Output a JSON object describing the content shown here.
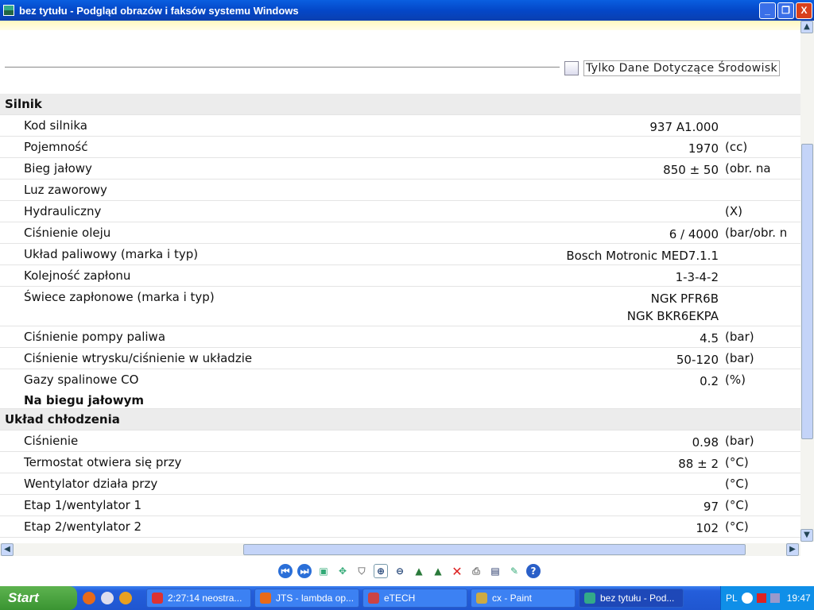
{
  "window": {
    "title": "bez tytułu - Podgląd obrazów i faksów systemu Windows",
    "min": "_",
    "max": "❐",
    "close": "X"
  },
  "env_checkbox": {
    "label": "Tylko Dane Dotyczące Środowisk",
    "checked": false
  },
  "sections": [
    {
      "title": "Silnik",
      "rows": [
        {
          "label": "Kod silnika",
          "value": "937 A1.000",
          "unit": ""
        },
        {
          "label": "Pojemność",
          "value": "1970",
          "unit": "(cc)"
        },
        {
          "label": "Bieg jałowy",
          "value": "850 ± 50",
          "unit": "(obr. na"
        },
        {
          "label": "Luz zaworowy",
          "value": "",
          "unit": ""
        },
        {
          "label": "Hydrauliczny",
          "value": "",
          "unit": "(X)"
        },
        {
          "label": "Ciśnienie oleju",
          "value": "6 / 4000",
          "unit": "(bar/obr. n"
        },
        {
          "label": "Układ paliwowy (marka i typ)",
          "value": "Bosch Motronic MED7.1.1",
          "unit": ""
        },
        {
          "label": "Kolejność zapłonu",
          "value": "1-3-4-2",
          "unit": ""
        },
        {
          "label": "Świece zapłonowe (marka i typ)",
          "value": "NGK PFR6B",
          "value2": "NGK BKR6EKPA",
          "unit": ""
        },
        {
          "label": "Ciśnienie pompy paliwa",
          "value": "4.5",
          "unit": "(bar)"
        },
        {
          "label": "Ciśnienie wtrysku/ciśnienie w układzie",
          "value": "50-120",
          "unit": "(bar)"
        },
        {
          "label": "Gazy spalinowe CO",
          "value": "0.2",
          "unit": "(%)",
          "sub": "Na biegu jałowym"
        }
      ]
    },
    {
      "title": "Układ chłodzenia",
      "rows": [
        {
          "label": "Ciśnienie",
          "value": "0.98",
          "unit": "(bar)"
        },
        {
          "label": "Termostat otwiera się przy",
          "value": "88 ± 2",
          "unit": "(°C)"
        },
        {
          "label": "Wentylator działa przy",
          "value": "",
          "unit": "(°C)"
        },
        {
          "label": "Etap 1/wentylator 1",
          "value": "97",
          "unit": "(°C)"
        },
        {
          "label": "Etap 2/wentylator 2",
          "value": "102",
          "unit": "(°C)"
        }
      ]
    }
  ],
  "taskbar": {
    "start": "Start",
    "tasks": [
      "2:27:14 neostra...",
      "JTS - lambda op...",
      "eTECH",
      "cx - Paint",
      "bez tytułu - Pod..."
    ],
    "lang": "PL",
    "clock": "19:47"
  }
}
